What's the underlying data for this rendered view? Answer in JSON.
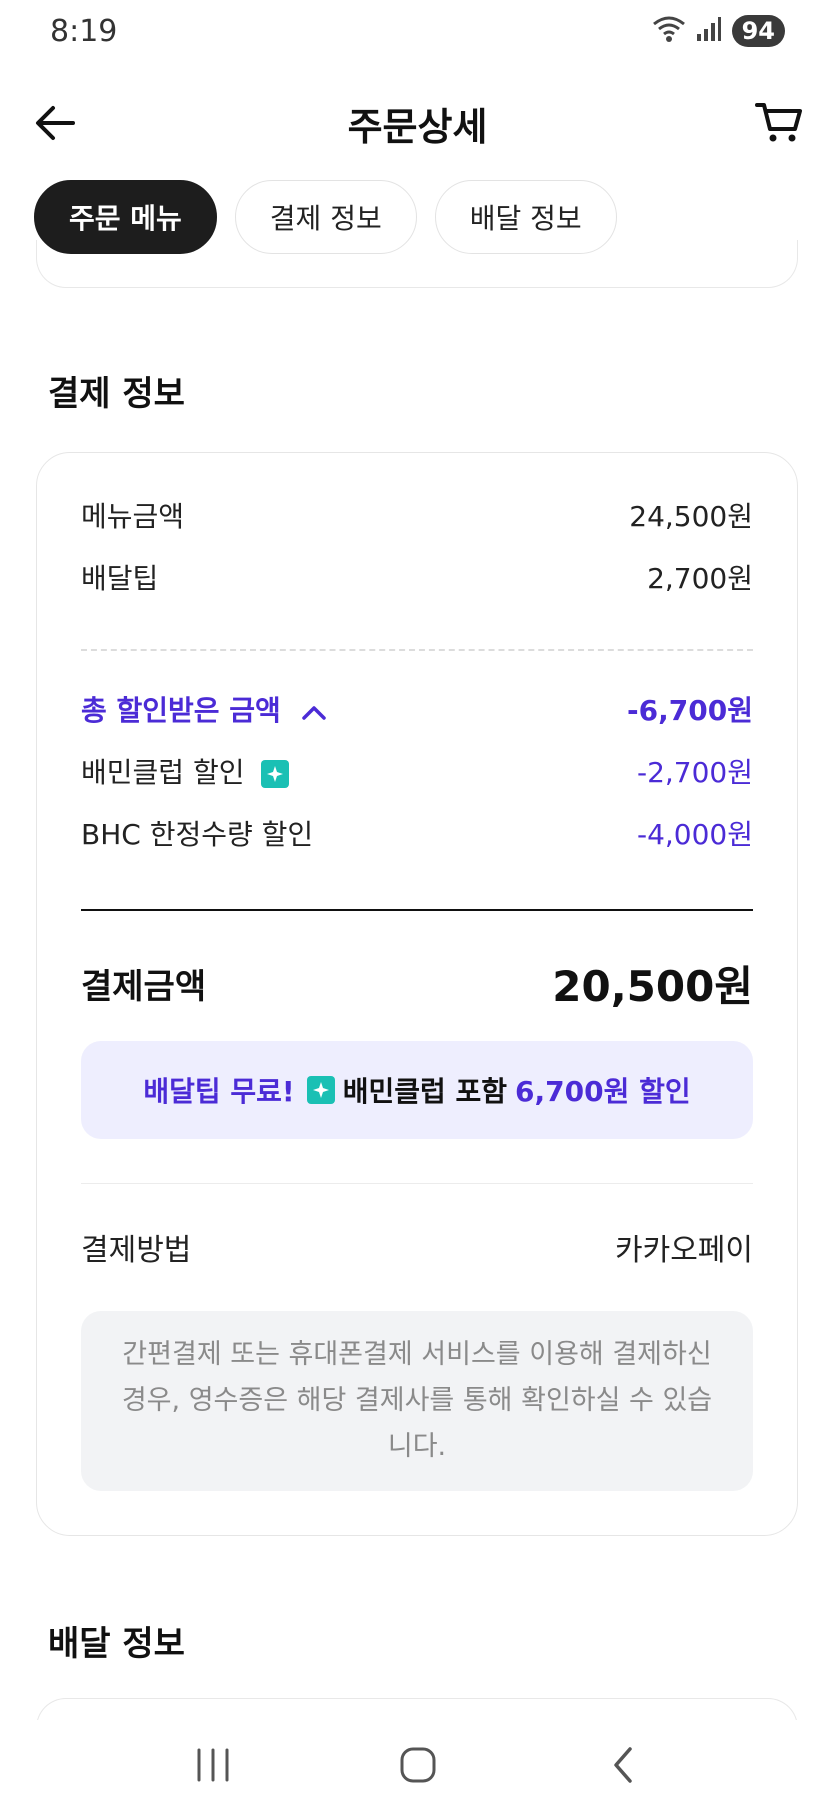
{
  "status_bar": {
    "time": "8:19",
    "battery": "94"
  },
  "header": {
    "title": "주문상세"
  },
  "tabs": [
    {
      "label": "주문 메뉴",
      "active": true
    },
    {
      "label": "결제 정보",
      "active": false
    },
    {
      "label": "배달 정보",
      "active": false
    }
  ],
  "payment_section": {
    "title": "결제 정보",
    "menu_amount_label": "메뉴금액",
    "menu_amount_value": "24,500원",
    "delivery_tip_label": "배달팁",
    "delivery_tip_value": "2,700원",
    "discount_total_label": "총 할인받은 금액",
    "discount_total_value": "-6,700원",
    "discounts": [
      {
        "label": "배민클럽 할인",
        "value": "-2,700원"
      },
      {
        "label": "BHC 한정수량 할인",
        "value": "-4,000원"
      }
    ],
    "total_label": "결제금액",
    "total_value": "20,500원",
    "promo": {
      "part1": "배달팁 무료!",
      "part2": "배민클럽 포함",
      "part3": "6,700원 할인"
    },
    "method_label": "결제방법",
    "method_value": "카카오페이",
    "notice": "간편결제 또는 휴대폰결제 서비스를 이용해 결제하신 경우, 영수증은 해당 결제사를 통해 확인하실 수 있습니다."
  },
  "delivery_section": {
    "title": "배달 정보"
  },
  "colors": {
    "accent": "#4b2bd6",
    "club_icon": "#1ac0b4",
    "promo_bg": "#eeeefe"
  }
}
